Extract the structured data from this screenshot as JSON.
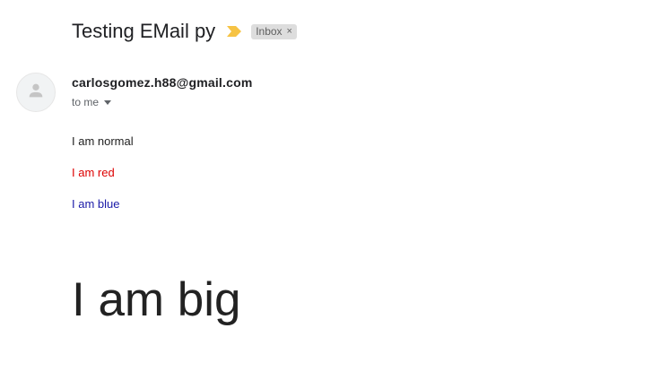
{
  "email": {
    "subject": "Testing EMail py",
    "important_icon": "importance-marker-icon",
    "label": {
      "text": "Inbox",
      "close_glyph": "×"
    },
    "sender": "carlosgomez.h88@gmail.com",
    "recipient": "to me",
    "avatar_icon": "person-icon",
    "body": {
      "line_normal": "I am normal",
      "line_red": "I am red",
      "line_blue": "I am blue",
      "line_big": "I am big"
    }
  },
  "colors": {
    "important_marker": "#f6c344",
    "label_bg": "#dddddd",
    "red_text": "#dd0000",
    "blue_text": "#1a1aa8"
  }
}
